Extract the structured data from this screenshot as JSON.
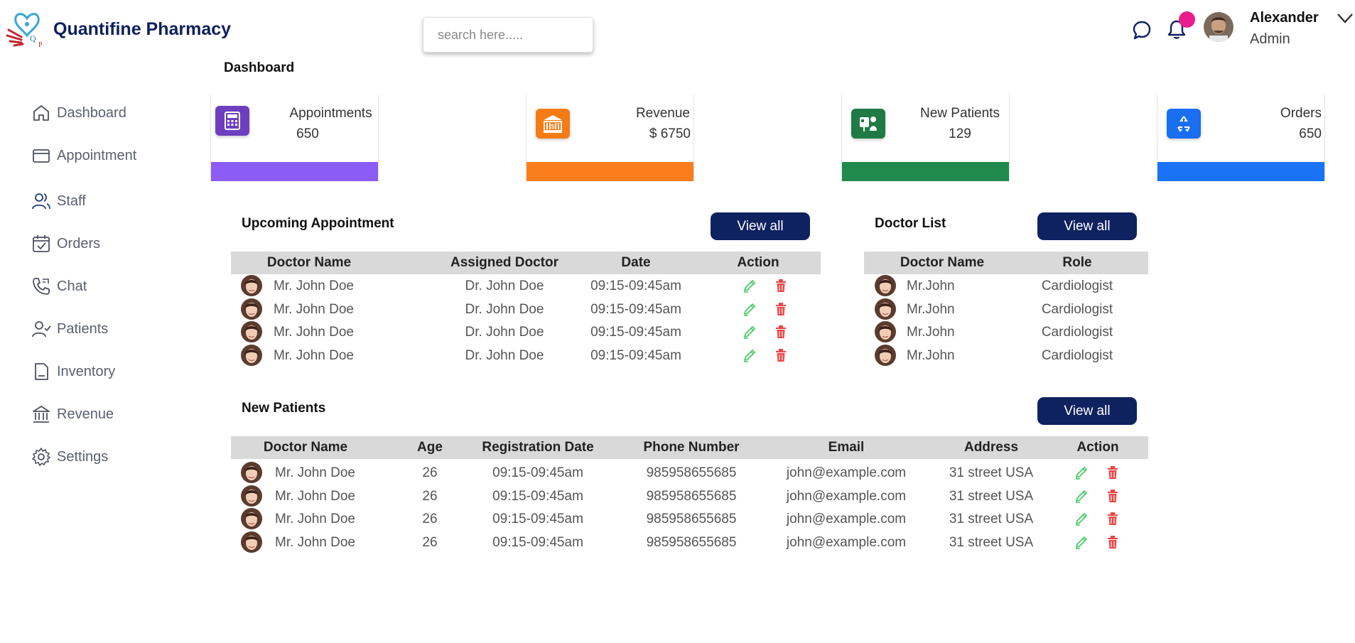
{
  "header": {
    "brand": "Quantifine Pharmacy",
    "search_placeholder": "search here.....",
    "user_name": "Alexander",
    "user_role": "Admin",
    "notification_dot_color": "#e91e8c"
  },
  "page_title": "Dashboard",
  "sidebar": {
    "items": [
      {
        "label": "Dashboard",
        "icon": "home-icon"
      },
      {
        "label": "Appointment",
        "icon": "card-icon"
      },
      {
        "label": "Staff",
        "icon": "users-icon"
      },
      {
        "label": "Orders",
        "icon": "calendar-check-icon"
      },
      {
        "label": "Chat",
        "icon": "phone-icon"
      },
      {
        "label": "Patients",
        "icon": "user-check-icon"
      },
      {
        "label": "Inventory",
        "icon": "document-icon"
      },
      {
        "label": "Revenue",
        "icon": "bank-icon"
      },
      {
        "label": "Settings",
        "icon": "gear-icon"
      }
    ]
  },
  "stats": [
    {
      "label": "Appointments",
      "value": "650",
      "color": "#8b5cf6",
      "icon_bg": "#6d3fc0",
      "icon": "calculator-icon"
    },
    {
      "label": "Revenue",
      "value": "$ 6750",
      "color": "#fb7e1c",
      "icon_bg": "#f57c14",
      "icon": "bank-icon"
    },
    {
      "label": "New Patients",
      "value": "129",
      "color": "#1f8a4c",
      "icon_bg": "#1f7a45",
      "icon": "doctor-icon"
    },
    {
      "label": "Orders",
      "value": "650",
      "color": "#1a73f5",
      "icon_bg": "#1a6ff0",
      "icon": "recycle-icon"
    }
  ],
  "upcoming": {
    "title": "Upcoming Appointment",
    "view_all": "View all",
    "columns": [
      "Doctor Name",
      "Assigned Doctor",
      "Date",
      "Action"
    ],
    "rows": [
      {
        "name": "Mr. John Doe",
        "assigned": "Dr. John Doe",
        "date": "09:15-09:45am"
      },
      {
        "name": "Mr. John Doe",
        "assigned": "Dr. John Doe",
        "date": "09:15-09:45am"
      },
      {
        "name": "Mr. John Doe",
        "assigned": "Dr. John Doe",
        "date": "09:15-09:45am"
      },
      {
        "name": "Mr. John Doe",
        "assigned": "Dr. John Doe",
        "date": "09:15-09:45am"
      }
    ]
  },
  "doctors": {
    "title": "Doctor List",
    "view_all": "View all",
    "columns": [
      "Doctor Name",
      "Role"
    ],
    "rows": [
      {
        "name": "Mr.John",
        "role": "Cardiologist"
      },
      {
        "name": "Mr.John",
        "role": "Cardiologist"
      },
      {
        "name": "Mr.John",
        "role": "Cardiologist"
      },
      {
        "name": "Mr.John",
        "role": "Cardiologist"
      }
    ]
  },
  "patients": {
    "title": "New Patients",
    "view_all": "View all",
    "columns": [
      "Doctor Name",
      "Age",
      "Registration Date",
      "Phone Number",
      "Email",
      "Address",
      "Action"
    ],
    "rows": [
      {
        "name": "Mr. John Doe",
        "age": "26",
        "reg": "09:15-09:45am",
        "phone": "985958655685",
        "email": "john@example.com",
        "address": "31 street USA"
      },
      {
        "name": "Mr. John Doe",
        "age": "26",
        "reg": "09:15-09:45am",
        "phone": "985958655685",
        "email": "john@example.com",
        "address": "31 street USA"
      },
      {
        "name": "Mr. John Doe",
        "age": "26",
        "reg": "09:15-09:45am",
        "phone": "985958655685",
        "email": "john@example.com",
        "address": "31 street USA"
      },
      {
        "name": "Mr. John Doe",
        "age": "26",
        "reg": "09:15-09:45am",
        "phone": "985958655685",
        "email": "john@example.com",
        "address": "31 street USA"
      }
    ]
  },
  "colors": {
    "navy": "#0f2260",
    "edit": "#4ccb6a",
    "delete": "#ef4444",
    "table_header": "#d9d9d9"
  }
}
